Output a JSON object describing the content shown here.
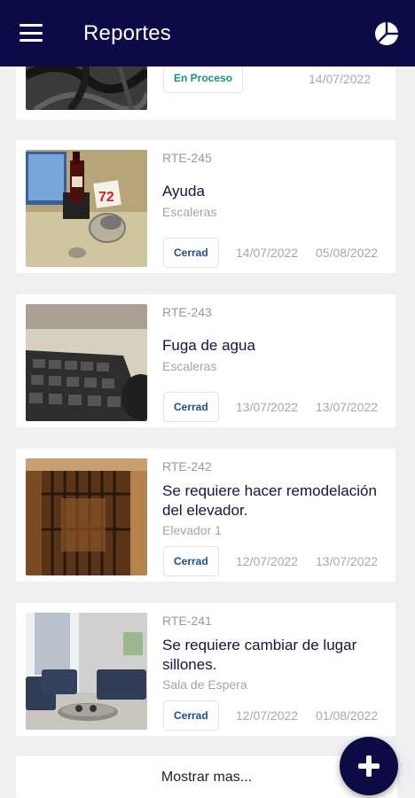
{
  "appbar": {
    "title": "Reportes",
    "menu_icon": "menu-icon",
    "chart_icon": "pie-chart-icon"
  },
  "reports": [
    {
      "code": "",
      "title": "",
      "location": "",
      "status": "En Proceso",
      "date_start": "14/07/2022",
      "date_end": ""
    },
    {
      "code": "RTE-245",
      "title": "Ayuda",
      "location": "Escaleras",
      "status": "Cerrad",
      "date_start": "14/07/2022",
      "date_end": "05/08/2022",
      "price_tag": "72"
    },
    {
      "code": "RTE-243",
      "title": "Fuga de agua",
      "location": "Escaleras",
      "status": "Cerrad",
      "date_start": "13/07/2022",
      "date_end": "13/07/2022"
    },
    {
      "code": "RTE-242",
      "title": "Se requiere hacer remodelación del elevador.",
      "location": "Elevador 1",
      "status": "Cerrad",
      "date_start": "12/07/2022",
      "date_end": "13/07/2022"
    },
    {
      "code": "RTE-241",
      "title": "Se requiere cambiar de lugar sillones.",
      "location": "Sala de Espera",
      "status": "Cerrad",
      "date_start": "12/07/2022",
      "date_end": "01/08/2022"
    }
  ],
  "show_more_label": "Mostrar mas...",
  "fab_icon": "plus-icon",
  "colors": {
    "primary": "#0c0b45",
    "status_process": "#1d8f86",
    "status_closed": "#1e4d8f"
  }
}
